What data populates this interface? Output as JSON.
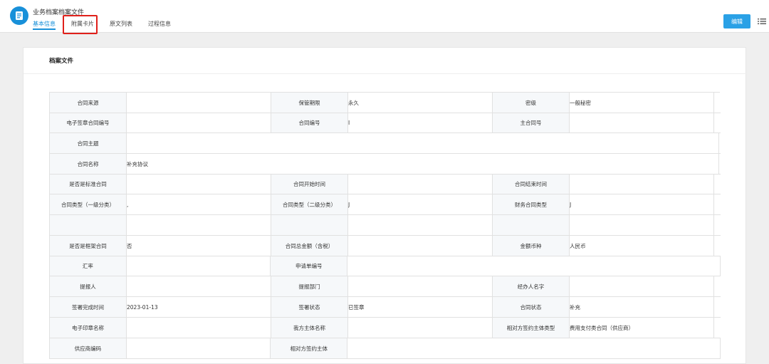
{
  "header": {
    "app_title": "业务档案档案文件",
    "tabs": [
      {
        "label": "基本信息",
        "active": true
      },
      {
        "label": "附属卡片",
        "active": false
      },
      {
        "label": "原文列表",
        "active": false
      },
      {
        "label": "过程信息",
        "active": false
      }
    ],
    "edit_label": "编辑"
  },
  "card": {
    "title": "档案文件"
  },
  "form": {
    "rows": [
      {
        "cells": [
          {
            "label": "合同来源",
            "value": ""
          },
          {
            "label": "保管期限",
            "value": "永久"
          },
          {
            "label": "密级",
            "value": "一般秘密"
          }
        ]
      },
      {
        "cells": [
          {
            "label": "电子签章合同编号",
            "value": ""
          },
          {
            "label": "合同编号",
            "value": "I"
          },
          {
            "label": "主合同号",
            "value": ""
          }
        ]
      },
      {
        "cells": [
          {
            "label": "合同主题",
            "value": ""
          }
        ]
      },
      {
        "cells": [
          {
            "label": "合同名称",
            "value": "补充协议"
          }
        ]
      },
      {
        "cells": [
          {
            "label": "是否是标准合同",
            "value": ""
          },
          {
            "label": "合同开始时间",
            "value": ""
          },
          {
            "label": "合同结束时间",
            "value": ""
          }
        ]
      },
      {
        "cells": [
          {
            "label": "合同类型（一级分类）",
            "value": ","
          },
          {
            "label": "合同类型（二级分类）",
            "value": "J"
          },
          {
            "label": "财务合同类型",
            "value": "J"
          }
        ]
      },
      {
        "cells": [
          {
            "label": "",
            "value": ""
          },
          {
            "label": "",
            "value": ""
          },
          {
            "label": "",
            "value": ""
          }
        ]
      },
      {
        "cells": [
          {
            "label": "是否是框架合同",
            "value": "否"
          },
          {
            "label": "合同总金额（含税）",
            "value": ""
          },
          {
            "label": "金额币种",
            "value": "人民币"
          }
        ]
      },
      {
        "cells": [
          {
            "label": "汇率",
            "value": ""
          },
          {
            "label": "申请单编号",
            "value": ""
          }
        ]
      },
      {
        "cells": [
          {
            "label": "提报人",
            "value": ""
          },
          {
            "label": "提报部门",
            "value": ""
          },
          {
            "label": "经办人名字",
            "value": ""
          }
        ]
      },
      {
        "cells": [
          {
            "label": "签署完成时间",
            "value": "2023-01-13"
          },
          {
            "label": "签署状态",
            "value": "已签章"
          },
          {
            "label": "合同状态",
            "value": "补充"
          }
        ]
      },
      {
        "cells": [
          {
            "label": "电子印章名称",
            "value": ""
          },
          {
            "label": "我方主体名称",
            "value": ""
          },
          {
            "label": "相对方签约主体类型",
            "value": "费用支付类合同（供应商）"
          }
        ]
      },
      {
        "cells": [
          {
            "label": "供应商编码",
            "value": ""
          },
          {
            "label": "相对方签约主体",
            "value": ""
          }
        ]
      }
    ]
  },
  "colors": {
    "accent": "#1890d9",
    "button": "#2aa1e6",
    "highlight_box": "#e0201a",
    "label_bg": "#f6f8fa"
  },
  "icons": {
    "logo": "document-icon",
    "menu": "list-menu-icon"
  }
}
